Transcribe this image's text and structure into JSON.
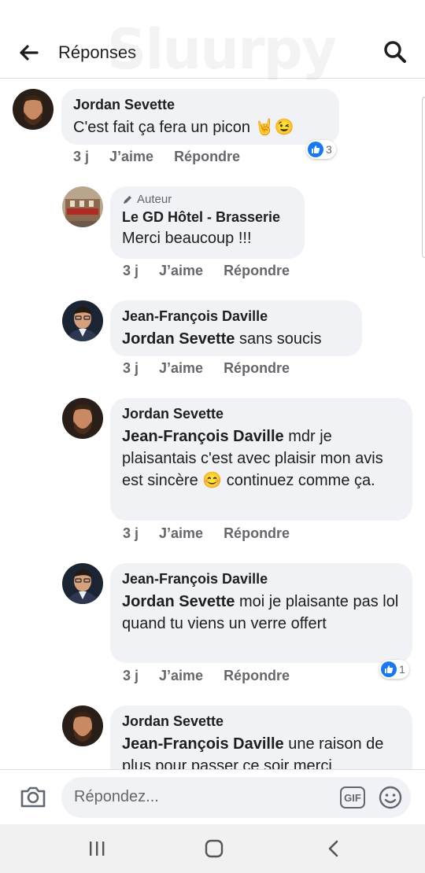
{
  "header": {
    "title": "Réponses",
    "back_icon": "arrow-left-icon",
    "search_icon": "search-icon"
  },
  "watermark": {
    "text": "Sluurpy"
  },
  "comments": [
    {
      "author": "Jordan Sevette",
      "text": "C'est fait ça fera un picon 🤘😉",
      "time": "3 j",
      "like": "J’aime",
      "reply": "Répondre",
      "reaction_count": "3"
    },
    {
      "badge": "Auteur",
      "author": "Le GD Hôtel - Brasserie",
      "text": "Merci beaucoup !!!",
      "time": "3 j",
      "like": "J’aime",
      "reply": "Répondre"
    },
    {
      "author": "Jean-François Daville",
      "mention": "Jordan Sevette",
      "text": " sans soucis",
      "time": "3 j",
      "like": "J’aime",
      "reply": "Répondre"
    },
    {
      "author": "Jordan Sevette",
      "mention": "Jean-François Daville",
      "text": " mdr je plaisantais c'est avec plaisir mon avis est sincère 😊 continuez comme ça.",
      "time": "3 j",
      "like": "J’aime",
      "reply": "Répondre"
    },
    {
      "author": "Jean-François Daville",
      "mention": "Jordan Sevette",
      "text": " moi je plaisante pas lol quand tu viens un verre offert",
      "time": "3 j",
      "like": "J’aime",
      "reply": "Répondre",
      "reaction_count": "1"
    },
    {
      "author": "Jordan Sevette",
      "mention": "Jean-François Daville",
      "text": " une raison de plus pour passer ce soir merci"
    }
  ],
  "composer": {
    "placeholder": "Répondez...",
    "gif_label": "GIF",
    "camera_icon": "camera-icon",
    "emoji_icon": "smiley-icon"
  },
  "navbar": {
    "recents_icon": "recents-icon",
    "home_icon": "home-icon",
    "back_icon": "back-chevron-icon"
  },
  "colors": {
    "accent": "#1877f2",
    "bubble": "#f0f2f5",
    "meta": "#65676b"
  }
}
